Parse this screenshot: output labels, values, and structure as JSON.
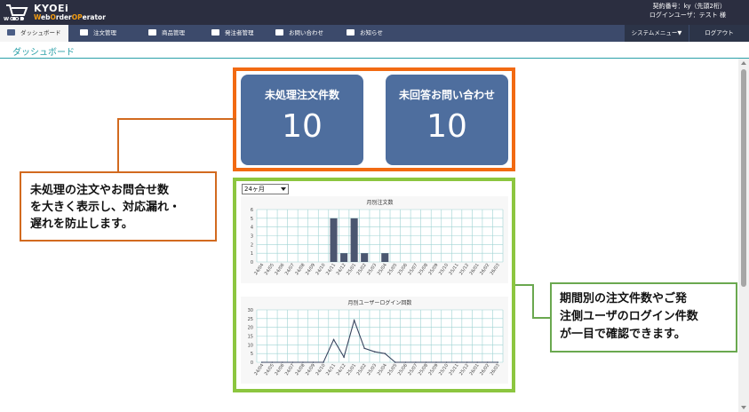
{
  "header": {
    "brand": "KYOEi",
    "sub_pre": "W",
    "sub_a": "eb",
    "sub_b": "O",
    "sub_c": "rder",
    "sub_d": "OP",
    "sub_e": "erator",
    "woop": "WOOP",
    "contract_line": "契約番号：ky（先頭2桁）",
    "user_line": "ログインユーザ：テスト 様"
  },
  "nav": {
    "items": [
      {
        "label": "ダッシュボード",
        "icon": "dashboard-icon",
        "active": true
      },
      {
        "label": "注文管理",
        "icon": "truck-icon"
      },
      {
        "label": "商品管理",
        "icon": "box-icon"
      },
      {
        "label": "発注者管理",
        "icon": "building-icon"
      },
      {
        "label": "お問い合わせ",
        "icon": "mail-icon"
      },
      {
        "label": "お知らせ",
        "icon": "bell-icon"
      }
    ],
    "system_menu": "システムメニュー▼",
    "logout": "ログアウト"
  },
  "page": {
    "title": "ダッシュボード"
  },
  "cards": [
    {
      "label": "未処理注文件数",
      "value": "10"
    },
    {
      "label": "未回答お問い合わせ",
      "value": "10"
    }
  ],
  "period_select": {
    "value": "24ヶ月"
  },
  "callouts": {
    "orange": [
      "未処理の注文やお問合せ数",
      "を大きく表示し、対応漏れ・",
      "遅れを防止します。"
    ],
    "green": [
      "期間別の注文件数やご発",
      "注側ユーザのログイン件数",
      "が一目で確認できます。"
    ]
  },
  "colors": {
    "header_bg": "#2b2e40",
    "nav_bg": "#3c4a6b",
    "accent_teal": "#2aa0a8",
    "card_bg": "#4e6e9e",
    "highlight_orange": "#f26a12",
    "highlight_green": "#8cc63f",
    "bar_color": "#4b5670"
  },
  "chart_data": [
    {
      "type": "bar",
      "title": "月別注文数",
      "categories": [
        "24/04",
        "24/05",
        "24/06",
        "24/07",
        "24/08",
        "24/09",
        "24/10",
        "24/11",
        "24/12",
        "25/01",
        "25/02",
        "25/03",
        "25/04",
        "25/05",
        "25/06",
        "25/07",
        "25/08",
        "25/09",
        "25/10",
        "25/11",
        "25/12",
        "26/01",
        "26/02",
        "26/03"
      ],
      "values": [
        0,
        0,
        0,
        0,
        0,
        0,
        0,
        5,
        1,
        5,
        1,
        0,
        1,
        0,
        0,
        0,
        0,
        0,
        0,
        0,
        0,
        0,
        0,
        0
      ],
      "ylim": [
        0,
        6
      ],
      "yticks": [
        0,
        1,
        2,
        3,
        4,
        5,
        6
      ],
      "grid": true
    },
    {
      "type": "line",
      "title": "月別ユーザーログイン回数",
      "categories": [
        "24/04",
        "24/05",
        "24/06",
        "24/07",
        "24/08",
        "24/09",
        "24/10",
        "24/11",
        "24/12",
        "25/01",
        "25/02",
        "25/03",
        "25/04",
        "25/05",
        "25/06",
        "25/07",
        "25/08",
        "25/09",
        "25/10",
        "25/11",
        "25/12",
        "26/01",
        "26/02",
        "26/03"
      ],
      "values": [
        0,
        0,
        0,
        0,
        0,
        0,
        0,
        13,
        3,
        24,
        8,
        6,
        5,
        0,
        0,
        0,
        0,
        0,
        0,
        0,
        0,
        0,
        0,
        0
      ],
      "ylim": [
        0,
        30
      ],
      "yticks": [
        0,
        5,
        10,
        15,
        20,
        25,
        30
      ],
      "grid": true
    }
  ]
}
